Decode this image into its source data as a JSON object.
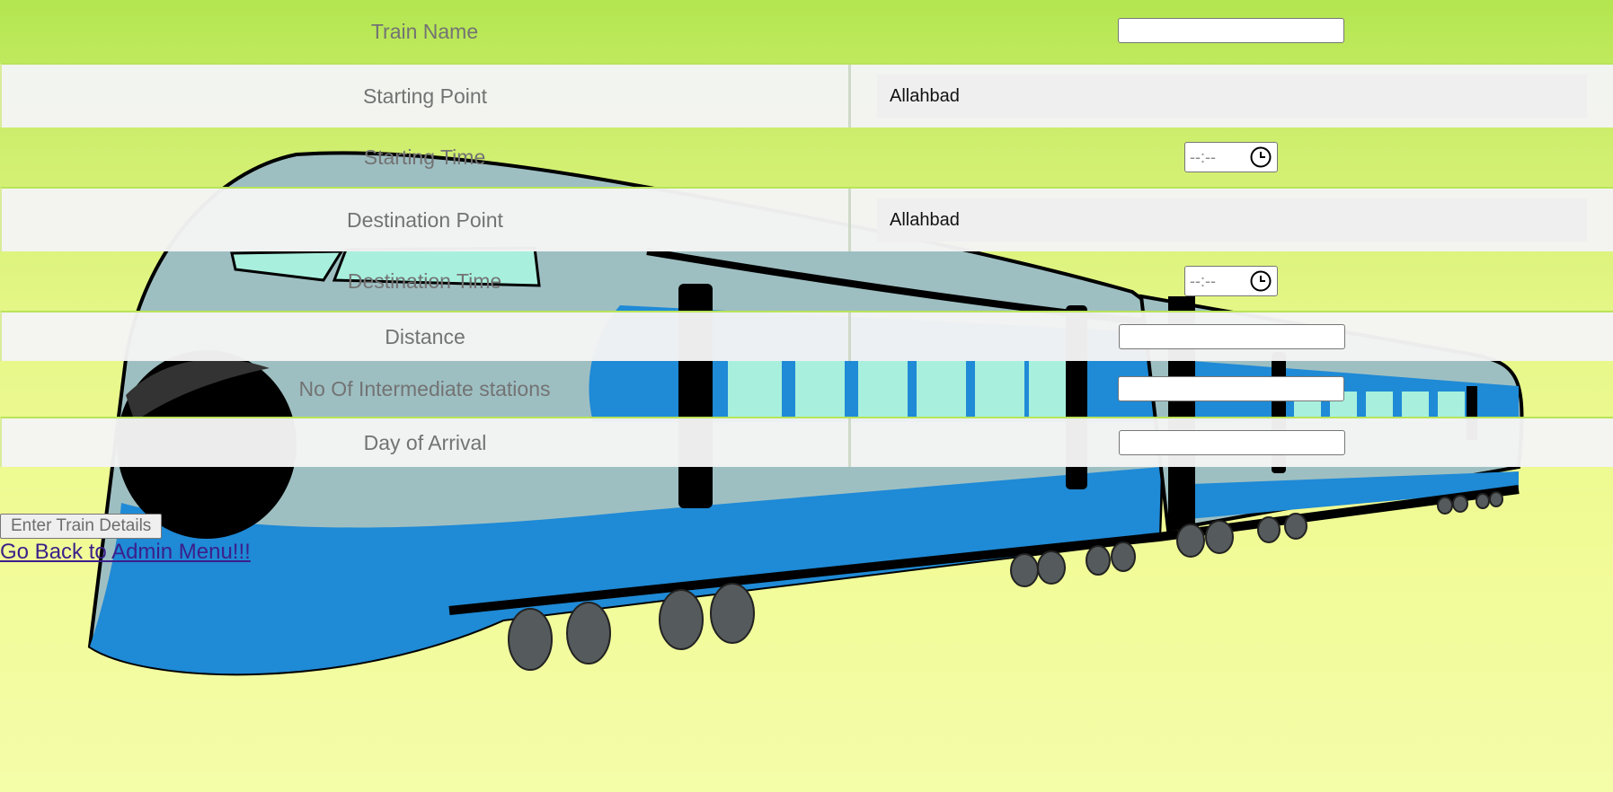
{
  "form": {
    "rows": [
      {
        "label": "Train Name",
        "type": "text",
        "value": ""
      },
      {
        "label": "Starting Point",
        "type": "select",
        "value": "Allahbad"
      },
      {
        "label": "Starting Time",
        "type": "time",
        "placeholder": "--:--"
      },
      {
        "label": "Destination Point",
        "type": "select",
        "value": "Allahbad"
      },
      {
        "label": "Destination Time",
        "type": "time",
        "placeholder": "--:--"
      },
      {
        "label": "Distance",
        "type": "text",
        "value": ""
      },
      {
        "label": "No Of Intermediate stations",
        "type": "text",
        "value": ""
      },
      {
        "label": "Day of Arrival",
        "type": "text",
        "value": ""
      }
    ]
  },
  "actions": {
    "submit_label": "Enter Train Details",
    "back_link": "Go Back to Admin Menu!!!"
  },
  "colors": {
    "bg_top": "#b3e650",
    "bg_bottom": "#f4fda8",
    "train_body": "#9ebfc2",
    "train_stripe": "#1f8ad6",
    "link": "#3b1f8a"
  },
  "background_icon": "train-illustration"
}
